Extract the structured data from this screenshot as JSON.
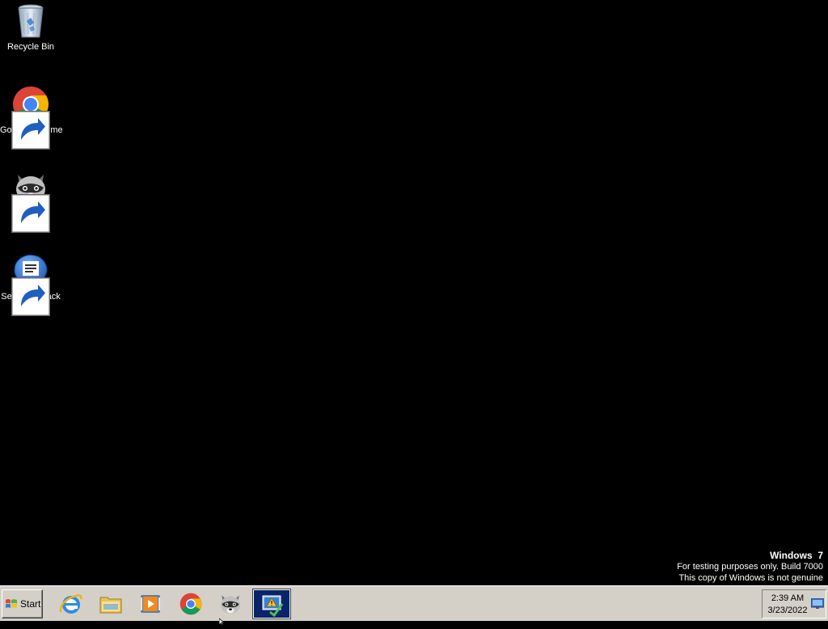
{
  "desktop": {
    "icons": [
      {
        "label": "Recycle Bin",
        "icon": "recycle-bin-icon"
      },
      {
        "label": "Google Chrome",
        "icon": "chrome-icon"
      },
      {
        "label": "Mypal",
        "icon": "mypal-raccoon-icon"
      },
      {
        "label": "Send feedback",
        "icon": "feedback-icon"
      }
    ]
  },
  "watermark": {
    "title": "Windows  7",
    "line1": "For testing purposes only. Build 7000",
    "line2": "This copy of Windows is not genuine"
  },
  "taskbar": {
    "start_label": "Start",
    "pinned": [
      {
        "icon": "internet-explorer-icon"
      },
      {
        "icon": "file-explorer-icon"
      },
      {
        "icon": "media-player-icon"
      },
      {
        "icon": "chrome-icon"
      },
      {
        "icon": "mypal-raccoon-icon"
      },
      {
        "icon": "action-center-icon",
        "active": true
      }
    ],
    "clock": {
      "time": "2:39 AM",
      "date": "3/23/2022"
    }
  },
  "colors": {
    "desktop_bg": "#000000",
    "taskbar_bg": "#d4d0c8",
    "active_task_bg": "#0a246a"
  }
}
